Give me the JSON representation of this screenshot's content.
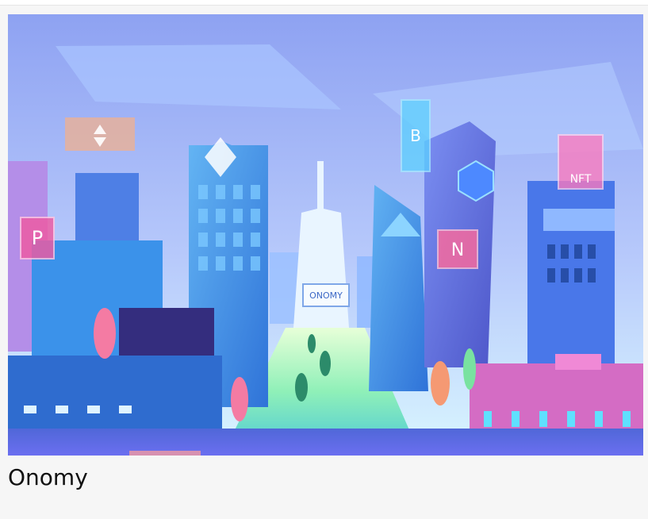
{
  "card": {
    "title": "Onomy",
    "image_description_name": "onomy-city-illustration"
  },
  "illustration": {
    "tower_sign": "ONOMY",
    "nft_sign": "NFT"
  },
  "colors": {
    "page_bg": "#f6f6f6",
    "sky_top": "#8ea2f2",
    "sky_bottom": "#cfe0ff",
    "street_glow": "#9ff2b5",
    "pink_building": "#d46cc4",
    "blue_building": "#3f7ee6"
  }
}
